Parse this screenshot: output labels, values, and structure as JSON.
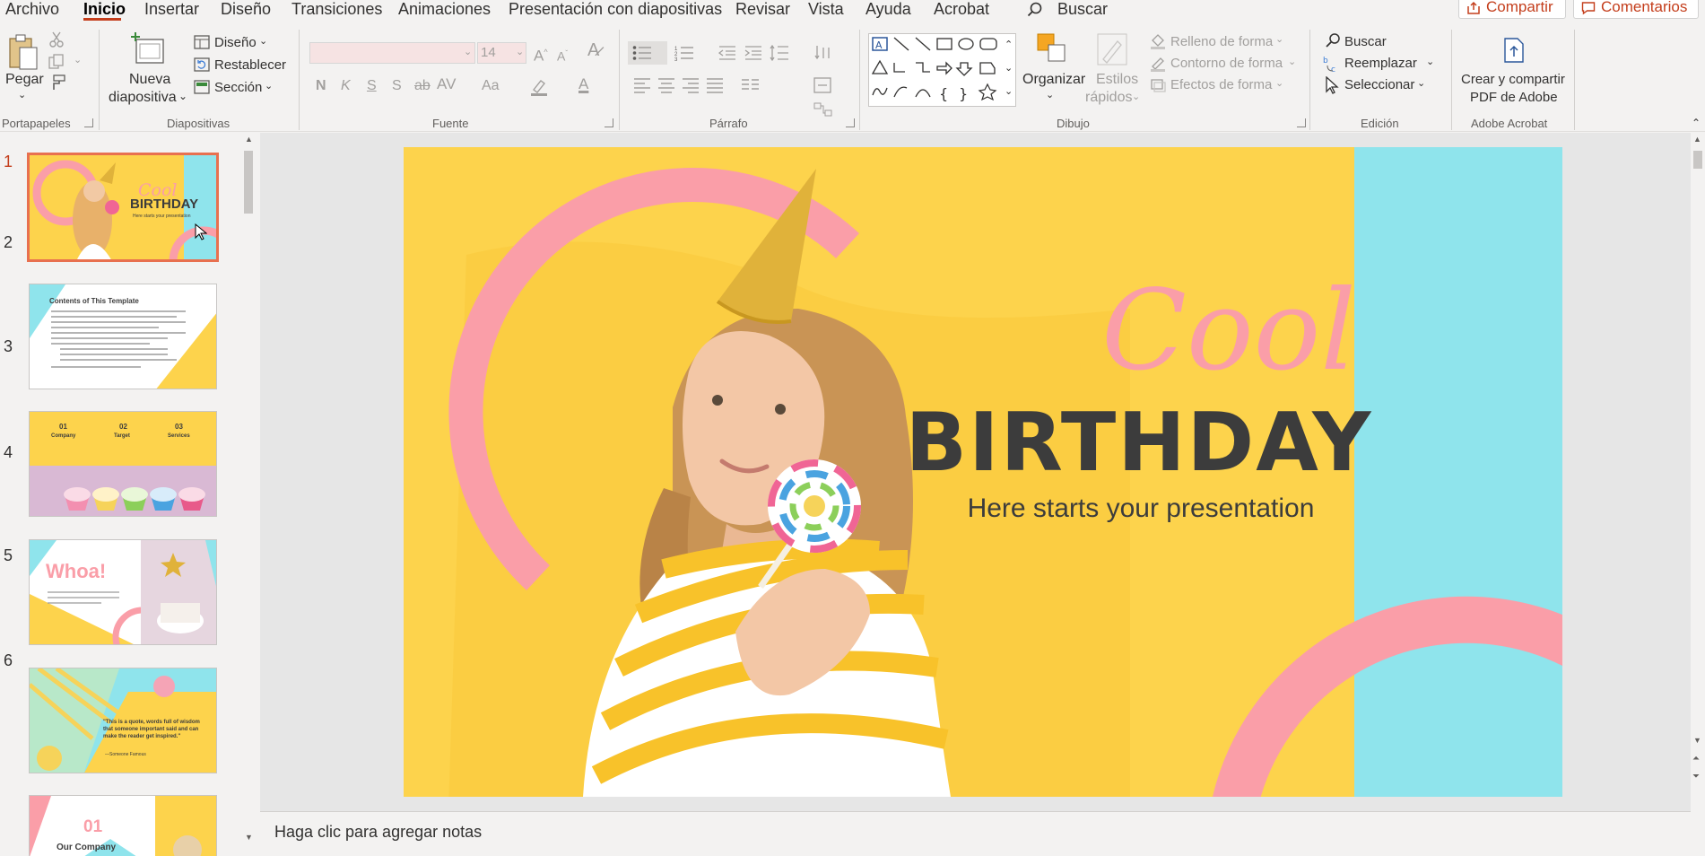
{
  "menu": {
    "items": [
      "Archivo",
      "Inicio",
      "Insertar",
      "Diseño",
      "Transiciones",
      "Animaciones",
      "Presentación con diapositivas",
      "Revisar",
      "Vista",
      "Ayuda",
      "Acrobat"
    ],
    "search_label": "Buscar",
    "share_label": "Compartir",
    "comments_label": "Comentarios"
  },
  "ribbon": {
    "portapapeles": {
      "paste": "Pegar",
      "label": "Portapapeles"
    },
    "diapositivas": {
      "new_slide_1": "Nueva",
      "new_slide_2": "diapositiva",
      "design": "Diseño",
      "reset": "Restablecer",
      "section": "Sección",
      "label": "Diapositivas"
    },
    "fuente": {
      "font_size": "14",
      "label": "Fuente"
    },
    "parrafo": {
      "label": "Párrafo"
    },
    "dibujo": {
      "arrange": "Organizar",
      "quick_styles_1": "Estilos",
      "quick_styles_2": "rápidos",
      "fill": "Relleno de forma",
      "outline": "Contorno de forma",
      "effects": "Efectos de forma",
      "label": "Dibujo"
    },
    "edicion": {
      "find": "Buscar",
      "replace": "Reemplazar",
      "select": "Seleccionar",
      "label": "Edición"
    },
    "acrobat": {
      "create_1": "Crear y compartir",
      "create_2": "PDF de Adobe",
      "label": "Adobe Acrobat"
    }
  },
  "thumbnails": [
    {
      "num": "1",
      "title": "Cool",
      "title2": "BIRTHDAY",
      "subtitle": "Here starts your presentation"
    },
    {
      "num": "2",
      "title": "Contents of This Template"
    },
    {
      "num": "3",
      "cols": [
        "01",
        "02",
        "03"
      ],
      "col_titles": [
        "Company",
        "Target",
        "Services"
      ]
    },
    {
      "num": "4",
      "title": "Whoa!"
    },
    {
      "num": "5",
      "quote": "\"This is a quote, words full of wisdom that someone important said and can make the reader get inspired.\"",
      "author": "—Someone Famous"
    },
    {
      "num": "6",
      "num_big": "01",
      "title": "Our Company"
    }
  ],
  "slide": {
    "title_script": "Cool",
    "title_main": "BIRTHDAY",
    "subtitle": "Here starts your presentation",
    "colors": {
      "background": "#fdd34c",
      "cyan": "#8fe4ec",
      "pink": "#fa9ea8",
      "title_dark": "#3c3c3c"
    }
  },
  "notes": {
    "placeholder": "Haga clic para agregar notas"
  }
}
